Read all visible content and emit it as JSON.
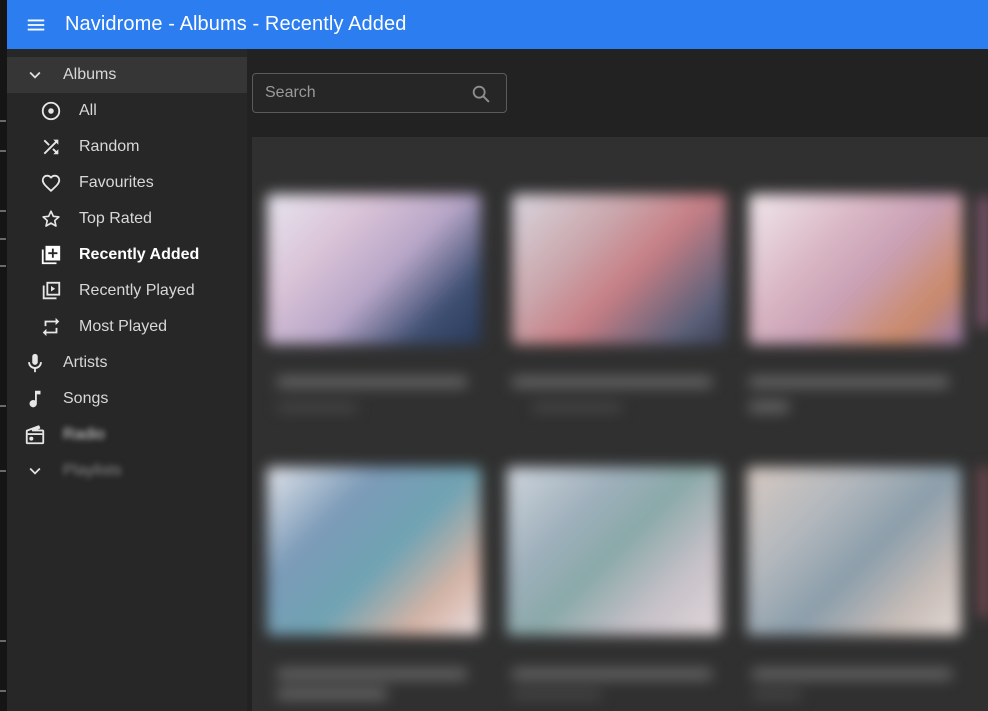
{
  "app": {
    "title": "Navidrome - Albums - Recently Added"
  },
  "sidebar": {
    "albums_label": "Albums",
    "items": [
      {
        "label": "All",
        "icon": "album-icon"
      },
      {
        "label": "Random",
        "icon": "shuffle-icon"
      },
      {
        "label": "Favourites",
        "icon": "heart-icon"
      },
      {
        "label": "Top Rated",
        "icon": "star-icon"
      },
      {
        "label": "Recently Added",
        "icon": "library-add-icon",
        "active": true
      },
      {
        "label": "Recently Played",
        "icon": "video-library-icon"
      },
      {
        "label": "Most Played",
        "icon": "repeat-icon"
      }
    ],
    "artists_label": "Artists",
    "songs_label": "Songs",
    "radio_label": "Radio",
    "playlists_label": "Playlists"
  },
  "search": {
    "placeholder": "Search",
    "value": ""
  },
  "colors": {
    "appbar": "#2b7df0",
    "sidebar": "#272727",
    "main": "#222222"
  }
}
